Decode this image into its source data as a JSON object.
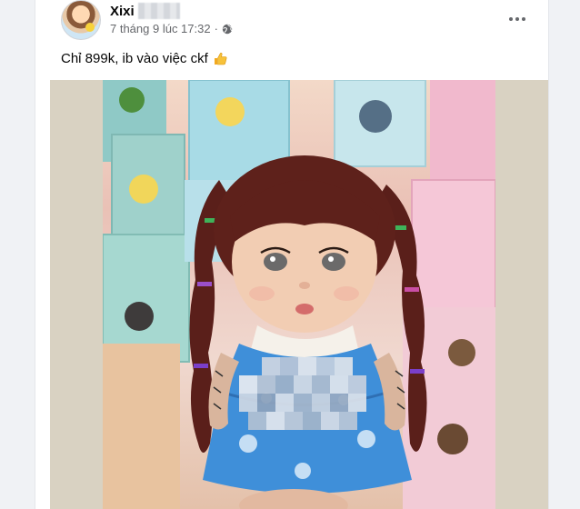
{
  "post": {
    "author_name": "Xixi",
    "timestamp": "7 tháng 9 lúc 17:32",
    "separator": "·",
    "audience_icon": "globe-icon",
    "more_icon": "more-options-icon",
    "text": "Chỉ 899k, ib vào việc ckf",
    "emoji_icon": "thumbs-up-icon"
  },
  "media": {
    "description_icon": "photo"
  },
  "colors": {
    "page_bg": "#f0f2f5",
    "card_bg": "#ffffff",
    "secondary_text": "#65676b",
    "primary_text": "#050505",
    "dress_blue": "#3f8fd9"
  }
}
